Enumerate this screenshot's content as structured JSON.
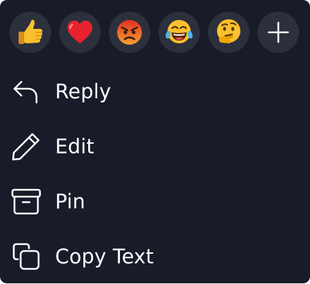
{
  "reactions": [
    {
      "name": "thumbs-up",
      "emoji": "👍"
    },
    {
      "name": "red-heart",
      "emoji": "❤️"
    },
    {
      "name": "angry-face",
      "emoji": "😡"
    },
    {
      "name": "face-with-tears-of-joy",
      "emoji": "😂"
    },
    {
      "name": "thinking-face",
      "emoji": "🤔"
    },
    {
      "name": "plus-icon",
      "emoji": ""
    }
  ],
  "menu": {
    "items": [
      {
        "label": "Reply",
        "icon": "reply-arrow-icon"
      },
      {
        "label": "Edit",
        "icon": "pencil-icon"
      },
      {
        "label": "Pin",
        "icon": "archive-box-icon"
      },
      {
        "label": "Copy Text",
        "icon": "copy-icon"
      }
    ]
  },
  "colors": {
    "background": "#181c29",
    "reaction_bubble": "#2c303c",
    "text": "#ffffff"
  }
}
